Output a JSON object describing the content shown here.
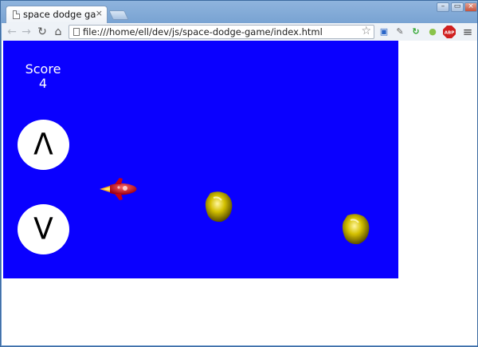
{
  "browser": {
    "tab_title": "space dodge gam",
    "tab_close": "×",
    "url": "file:///home/ell/dev/js/space-dodge-game/index.html",
    "window_controls": {
      "minimize": "–",
      "restore": "▭",
      "close": "×"
    },
    "nav": {
      "back": "←",
      "forward": "→",
      "reload": "↻",
      "home": "⌂"
    },
    "bookmark_star": "☆",
    "extensions": [
      {
        "name": "screen-icon",
        "glyph": "▣",
        "color": "#2a66c8"
      },
      {
        "name": "pin-icon",
        "glyph": "✎",
        "color": "#666666"
      },
      {
        "name": "refresh-circle-icon",
        "glyph": "↻",
        "color": "#2fa52f"
      },
      {
        "name": "android-icon",
        "glyph": "●",
        "color": "#8bc34a"
      },
      {
        "name": "adblock-icon",
        "glyph": "ABP",
        "color": "#d02020"
      },
      {
        "name": "menu-icon",
        "glyph": "≡",
        "color": "#444444"
      }
    ]
  },
  "game": {
    "background_color": "#0a00ff",
    "score_label": "Score",
    "score_value": "4",
    "up_button": "Λ",
    "down_button": "V"
  }
}
